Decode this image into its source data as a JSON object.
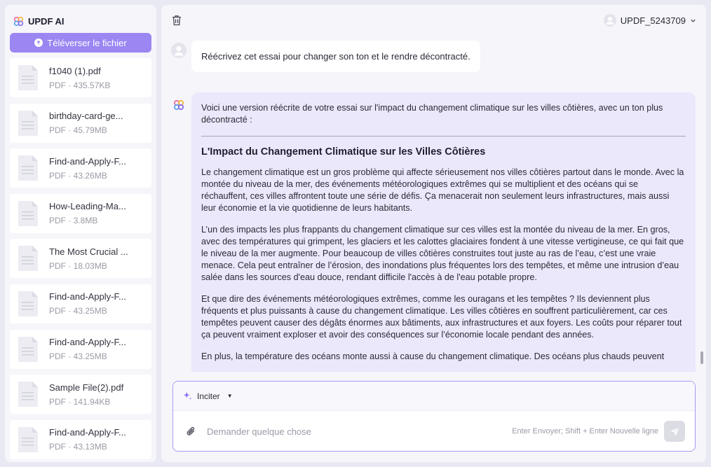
{
  "app": {
    "brand": "UPDF AI",
    "upload_label": "Téléverser le fichier"
  },
  "files": [
    {
      "name": "f1040 (1).pdf",
      "meta": "PDF · 435.57KB"
    },
    {
      "name": "birthday-card-ge...",
      "meta": "PDF · 45.79MB"
    },
    {
      "name": "Find-and-Apply-F...",
      "meta": "PDF · 43.26MB"
    },
    {
      "name": "How-Leading-Ma...",
      "meta": "PDF · 3.8MB"
    },
    {
      "name": "The Most Crucial ...",
      "meta": "PDF · 18.03MB"
    },
    {
      "name": "Find-and-Apply-F...",
      "meta": "PDF · 43.25MB"
    },
    {
      "name": "Find-and-Apply-F...",
      "meta": "PDF · 43.25MB"
    },
    {
      "name": "Sample File(2).pdf",
      "meta": "PDF · 141.94KB"
    },
    {
      "name": "Find-and-Apply-F...",
      "meta": "PDF · 43.13MB"
    }
  ],
  "header": {
    "username": "UPDF_5243709"
  },
  "chat": {
    "user_message": "Réécrivez cet essai pour changer son ton et le rendre décontracté.",
    "ai_intro": "Voici une version réécrite de votre essai sur l'impact du changement climatique sur les villes côtières, avec un ton plus décontracté :",
    "ai_heading": "L'Impact du Changement Climatique sur les Villes Côtières",
    "ai_paragraphs": [
      "Le changement climatique est un gros problème qui affecte sérieusement nos villes côtières partout dans le monde. Avec la montée du niveau de la mer, des événements météorologiques extrêmes qui se multiplient et des océans qui se réchauffent, ces villes affrontent toute une série de défis. Ça menacerait non seulement leurs infrastructures, mais aussi leur économie et la vie quotidienne de leurs habitants.",
      "L’un des impacts les plus frappants du changement climatique sur ces villes est la montée du niveau de la mer. En gros, avec des températures qui grimpent, les glaciers et les calottes glaciaires fondent à une vitesse vertigineuse, ce qui fait que le niveau de la mer augmente. Pour beaucoup de villes côtières construites tout juste au ras de l’eau, c’est une vraie menace. Cela peut entraîner de l’érosion, des inondations plus fréquentes lors des tempêtes, et même une intrusion d’eau salée dans les sources d'eau douce, rendant difficile l'accès à de l'eau potable propre.",
      "Et que dire des événements météorologiques extrêmes, comme les ouragans et les tempêtes ? Ils deviennent plus fréquents et plus puissants à cause du changement climatique. Les villes côtières en souffrent particulièrement, car ces tempêtes peuvent causer des dégâts énormes aux bâtiments, aux infrastructures et aux foyers. Les coûts pour réparer tout ça peuvent vraiment exploser et avoir des conséquences sur l’économie locale pendant des années.",
      "En plus, la température des océans monte aussi à cause du changement climatique. Des océans plus chauds peuvent"
    ]
  },
  "composer": {
    "prompt_label": "Inciter",
    "placeholder": "Demander quelque chose",
    "hint": "Enter Envoyer; Shift + Enter Nouvelle ligne"
  },
  "colors": {
    "accent": "#9b86f2",
    "ai_bubble": "#ebe8fb",
    "background": "#e9e9f3"
  }
}
